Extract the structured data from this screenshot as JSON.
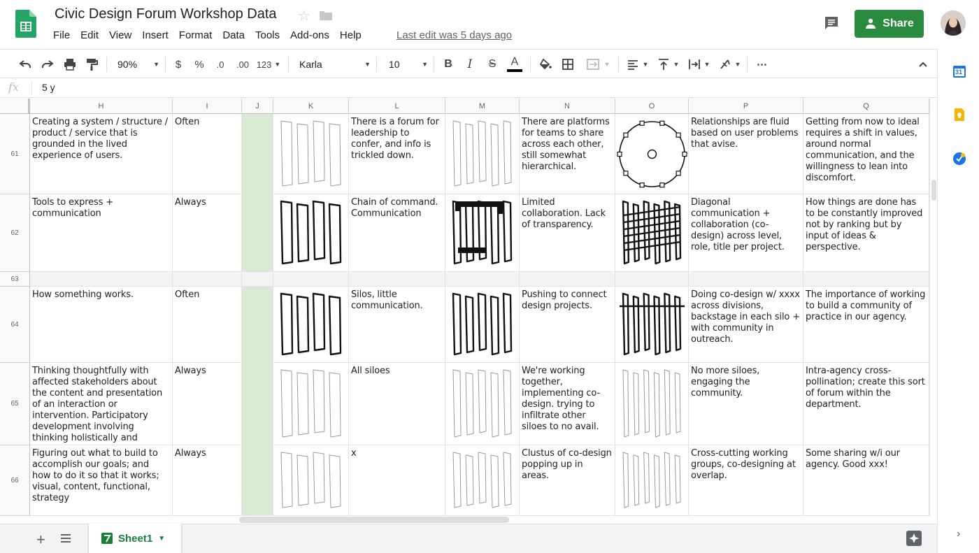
{
  "app": {
    "title": "Civic Design Forum Workshop Data",
    "last_edit": "Last edit was 5 days ago",
    "share_label": "Share",
    "accent": "#2a8a3e",
    "menu": [
      "File",
      "Edit",
      "View",
      "Insert",
      "Format",
      "Data",
      "Tools",
      "Add-ons",
      "Help"
    ]
  },
  "toolbar": {
    "zoom": "90%",
    "currency": "$",
    "percent": "%",
    "decrease_decimal": ".0",
    "increase_decimal": ".00",
    "more_formats": "123",
    "font": "Karla",
    "font_size": "10",
    "bold": "B",
    "italic": "I",
    "strike": "S",
    "text_color": "A"
  },
  "formula_bar": {
    "fx": "fx",
    "value": "5 y"
  },
  "columns": [
    "H",
    "I",
    "J",
    "K",
    "L",
    "M",
    "N",
    "O",
    "P",
    "Q"
  ],
  "row_numbers": [
    "61",
    "62",
    "63",
    "64",
    "65",
    "66"
  ],
  "rows": [
    {
      "H": "Creating a system / structure / product / service that is grounded in the lived experience of users.",
      "I": "Often",
      "L": "There is a forum for leadership to confer, and info is trickled down.",
      "N": "There are platforms for teams to share across each other, still somewhat hierarchical.",
      "P": "Relationships are fluid based on user problems that avise.",
      "Q": "Getting from now to ideal requires a shift in values, around normal communication, and the willingness to lean into discomfort."
    },
    {
      "H": "Tools to express + communication",
      "I": "Always",
      "L": "Chain of command. Communication",
      "N": "Limited collaboration. Lack of transparency.",
      "P": "Diagonal communication + collaboration (co-design) across level, role, title per project.",
      "Q": "How things are done has to be constantly improved not by ranking but by input of ideas & perspective."
    },
    {
      "H": "",
      "I": "",
      "L": "",
      "N": "",
      "P": "",
      "Q": ""
    },
    {
      "H": "How something works.",
      "I": "Often",
      "L": "Silos, little communication.",
      "N": "Pushing to connect design projects.",
      "P": "Doing co-design w/ xxxx across divisions, backstage in each silo + with community in outreach.",
      "Q": "The importance of working to build a community of practice in our agency."
    },
    {
      "H": "Thinking thoughtfully with affected stakeholders about the content and presentation of an interaction or intervention. Participatory development involving thinking holistically and collaboratively.",
      "I": "Always",
      "L": "All siloes",
      "N": "We're working together, implementing co-design. trying to infiltrate other siloes to no avail.",
      "P": "No more siloes, engaging the community.",
      "Q": "Intra-agency cross-pollination; create this sort of forum within the department."
    },
    {
      "H": "Figuring out what to build to accomplish our goals; and how to do it so that it works; visual, content, functional, strategy",
      "I": "Always",
      "L": "x",
      "N": "Clustus of co-design popping up in areas.",
      "P": "Cross-cutting working groups, co-designing at overlap.",
      "Q": "Some sharing w/i our agency. Good xxx!"
    }
  ],
  "sheet": {
    "tab_label": "Sheet1",
    "tab_color": "#188038"
  },
  "sidepanel": {
    "calendar_day": "31"
  },
  "colors": {
    "shade_column": "#d9ead3",
    "header_bg": "#f8f9fa"
  }
}
